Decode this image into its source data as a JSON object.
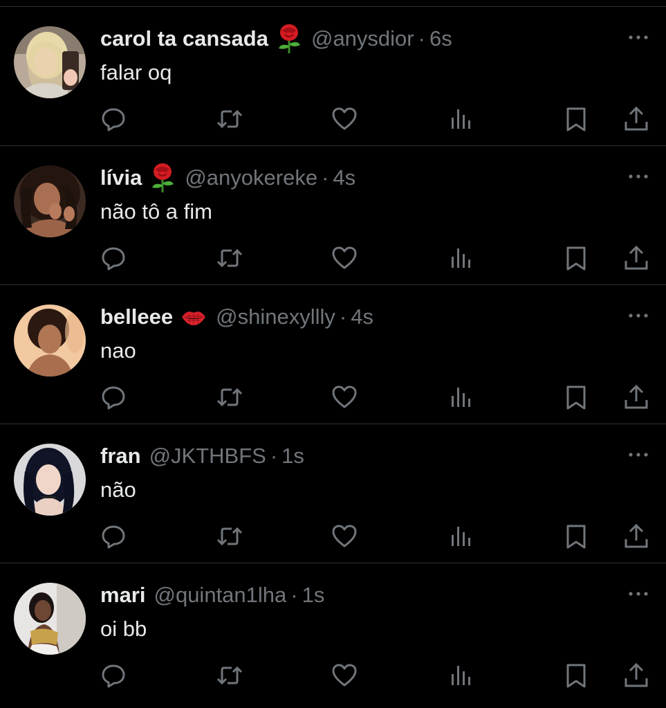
{
  "theme": {
    "background": "#000000",
    "text": "#e7e9ea",
    "muted": "#71767b",
    "divider": "#2f3336"
  },
  "tweets": [
    {
      "name": "carol ta cansada",
      "badge_icon": "rose-emoji",
      "handle": "@anysdior",
      "separator": "·",
      "time": "6s",
      "text": "falar oq"
    },
    {
      "name": "lívia",
      "badge_icon": "rose-emoji",
      "handle": "@anyokereke",
      "separator": "·",
      "time": "4s",
      "text": "não tô a fim"
    },
    {
      "name": "belleee",
      "badge_icon": "kiss-mark-emoji",
      "handle": "@shinexyllly",
      "separator": "·",
      "time": "4s",
      "text": "nao"
    },
    {
      "name": "fran",
      "badge_icon": "",
      "handle": "@JKTHBFS",
      "separator": "·",
      "time": "1s",
      "text": "não"
    },
    {
      "name": "mari",
      "badge_icon": "",
      "handle": "@quintan1lha",
      "separator": "·",
      "time": "1s",
      "text": "oi bb"
    }
  ],
  "action_icons": [
    "reply-icon",
    "retweet-icon",
    "like-icon",
    "views-icon",
    "bookmark-icon",
    "share-icon"
  ]
}
